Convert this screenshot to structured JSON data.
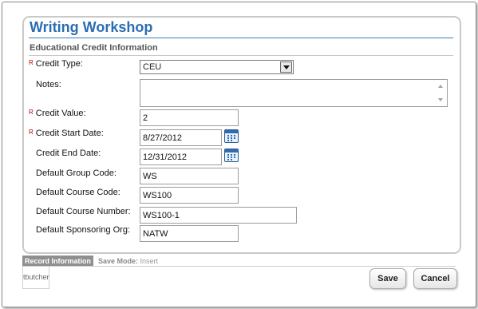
{
  "page": {
    "title": "Writing Workshop",
    "section": "Educational Credit Information"
  },
  "required_mark": "R",
  "fields": {
    "credit_type": {
      "label": "Credit Type:",
      "value": "CEU",
      "required": true
    },
    "notes": {
      "label": "Notes:",
      "value": ""
    },
    "credit_value": {
      "label": "Credit Value:",
      "value": "2",
      "required": true
    },
    "credit_start_date": {
      "label": "Credit Start Date:",
      "value": "8/27/2012",
      "required": true
    },
    "credit_end_date": {
      "label": "Credit End Date:",
      "value": "12/31/2012"
    },
    "default_group_code": {
      "label": "Default Group Code:",
      "value": "WS"
    },
    "default_course_code": {
      "label": "Default Course Code:",
      "value": "WS100"
    },
    "default_course_number": {
      "label": "Default Course Number:",
      "value": "WS100-1"
    },
    "default_sponsoring_org": {
      "label": "Default Sponsoring Org:",
      "value": "NATW"
    }
  },
  "record": {
    "tab_label": "Record Information",
    "save_mode_label": "Save Mode:",
    "save_mode_value": "Insert",
    "user": "tbutcher"
  },
  "buttons": {
    "save": "Save",
    "cancel": "Cancel"
  },
  "colors": {
    "title": "#2a6db3",
    "required": "#c00000",
    "record_tab": "#8f8f8f"
  },
  "icons": {
    "calendar": "calendar-icon",
    "dropdown": "chevron-down-icon"
  }
}
